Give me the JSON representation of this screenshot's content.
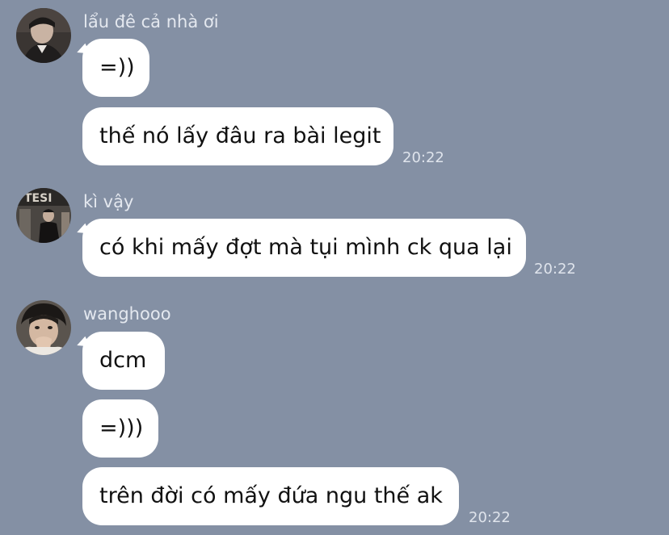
{
  "messages": [
    {
      "sender": "lẩu đê cả nhà ơi",
      "bubbles": [
        "=))",
        "thế nó lấy đâu ra bài legit"
      ],
      "time": "20:22"
    },
    {
      "sender": "kì vậy",
      "bubbles": [
        "có khi mấy đợt mà tụi mình ck qua lại"
      ],
      "time": "20:22"
    },
    {
      "sender": "wanghooo",
      "bubbles": [
        "dcm",
        "=)))",
        "trên đời có mấy đứa ngu thế ak"
      ],
      "time": "20:22"
    }
  ],
  "colors": {
    "background": "#8490a4",
    "bubble": "#ffffff"
  }
}
